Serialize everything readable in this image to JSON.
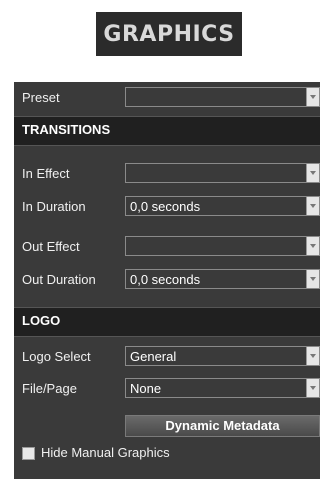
{
  "header": {
    "title": "GRAPHICS"
  },
  "preset": {
    "label": "Preset",
    "value": ""
  },
  "transitions": {
    "section_title": "TRANSITIONS",
    "in_effect": {
      "label": "In Effect",
      "value": ""
    },
    "in_duration": {
      "label": "In Duration",
      "value": "0,0  seconds"
    },
    "out_effect": {
      "label": "Out Effect",
      "value": ""
    },
    "out_duration": {
      "label": "Out Duration",
      "value": "0,0  seconds"
    }
  },
  "logo": {
    "section_title": "LOGO",
    "logo_select": {
      "label": "Logo Select",
      "value": "General"
    },
    "file_page": {
      "label": "File/Page",
      "value": "None"
    },
    "dynamic_metadata_button": "Dynamic Metadata"
  },
  "hide_manual_graphics": {
    "label": "Hide Manual Graphics",
    "checked": false
  },
  "colors": {
    "panel": "#3a3a3a",
    "section": "#202020",
    "badge": "#2b2b2b"
  }
}
